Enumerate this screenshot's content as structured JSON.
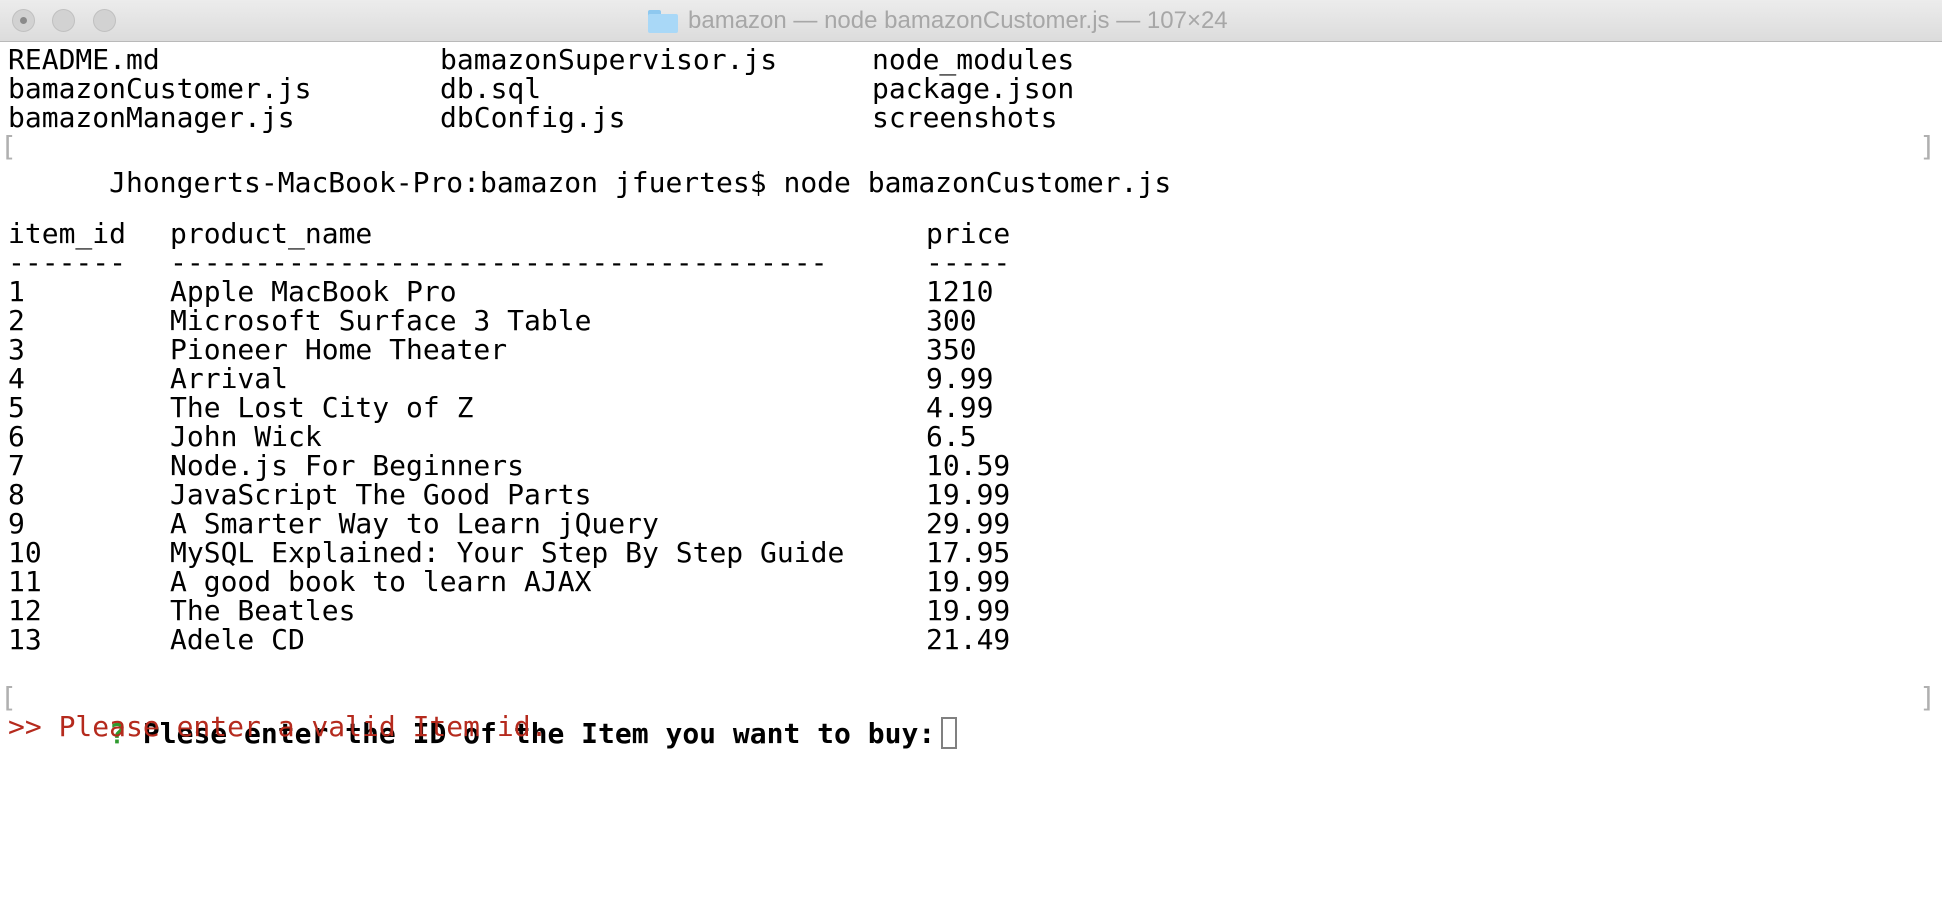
{
  "window": {
    "title": "bamazon — node bamazonCustomer.js — 107×24"
  },
  "ls": {
    "rows": [
      [
        "README.md",
        "bamazonSupervisor.js",
        "node_modules"
      ],
      [
        "bamazonCustomer.js",
        "db.sql",
        "package.json"
      ],
      [
        "bamazonManager.js",
        "dbConfig.js",
        "screenshots"
      ]
    ]
  },
  "command": {
    "prompt": "Jhongerts-MacBook-Pro:bamazon jfuertes$",
    "text": "node bamazonCustomer.js"
  },
  "table": {
    "headers": [
      "item_id",
      "product_name",
      "price"
    ],
    "separators": [
      "-------",
      "---------------------------------------",
      "-----"
    ],
    "rows": [
      [
        "1",
        "Apple MacBook Pro",
        "1210"
      ],
      [
        "2",
        "Microsoft Surface 3 Table",
        "300"
      ],
      [
        "3",
        "Pioneer Home Theater",
        "350"
      ],
      [
        "4",
        "Arrival",
        "9.99"
      ],
      [
        "5",
        "The Lost City of Z",
        "4.99"
      ],
      [
        "6",
        "John Wick",
        "6.5"
      ],
      [
        "7",
        "Node.js For Beginners",
        "10.59"
      ],
      [
        "8",
        "JavaScript The Good Parts",
        "19.99"
      ],
      [
        "9",
        "A Smarter Way to Learn jQuery",
        "29.99"
      ],
      [
        "10",
        "MySQL Explained: Your Step By Step Guide",
        "17.95"
      ],
      [
        "11",
        "A good book to learn AJAX",
        "19.99"
      ],
      [
        "12",
        "The Beatles",
        "19.99"
      ],
      [
        "13",
        "Adele CD",
        "21.49"
      ]
    ]
  },
  "question": {
    "mark": "?",
    "text": "Plese enter the ID of the Item you want to buy:",
    "value": ""
  },
  "error": {
    "text": ">> Please enter a valid Item id."
  },
  "colors": {
    "question_mark": "#2e9a2e",
    "error": "#b52a1d"
  }
}
